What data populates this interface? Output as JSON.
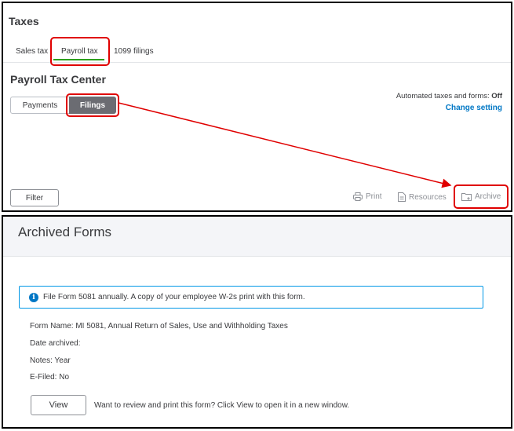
{
  "taxes": {
    "title": "Taxes",
    "tabs": [
      {
        "label": "Sales tax"
      },
      {
        "label": "Payroll tax"
      },
      {
        "label": "1099 filings"
      }
    ],
    "active_tab": "Payroll tax"
  },
  "payroll_tax_center": {
    "title": "Payroll Tax Center",
    "segments": [
      {
        "label": "Payments"
      },
      {
        "label": "Filings"
      }
    ],
    "active_segment": "Filings",
    "automated_label": "Automated taxes and forms:",
    "automated_value": "Off",
    "change_setting": "Change setting"
  },
  "toolbar": {
    "filter": "Filter",
    "print": "Print",
    "resources": "Resources",
    "archive": "Archive"
  },
  "archived_forms": {
    "title": "Archived Forms",
    "info": "File Form 5081 annually. A copy of your employee W-2s print with this form.",
    "form_name": "Form Name: MI 5081, Annual Return of Sales, Use and Withholding Taxes",
    "date_archived": "Date archived:",
    "notes": "Notes: Year",
    "efiled": "E-Filed: No",
    "view_button": "View",
    "view_hint": "Want to review and print this form? Click View to open it in a new window."
  },
  "colors": {
    "accent_green": "#2ca01c",
    "link_blue": "#0077c5",
    "annotation_red": "#e00000",
    "filings_active_bg": "#6b6c72"
  }
}
